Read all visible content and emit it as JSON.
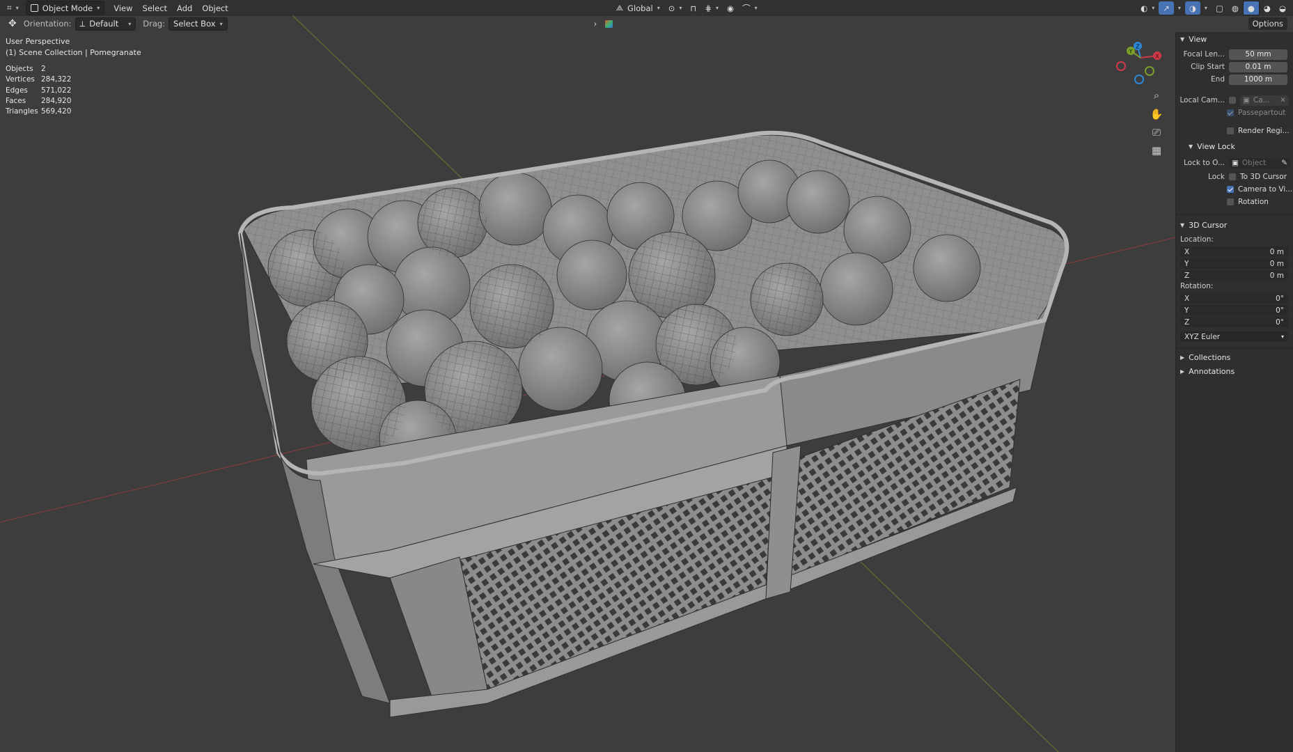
{
  "header": {
    "mode": "Object Mode",
    "menus": [
      "View",
      "Select",
      "Add",
      "Object"
    ],
    "transform_orientation": "Global",
    "options_label": "Options"
  },
  "tool_settings": {
    "orientation_label": "Orientation:",
    "orientation_value": "Default",
    "drag_label": "Drag:",
    "drag_value": "Select Box"
  },
  "viewport_info": {
    "perspective": "User Perspective",
    "collection": "(1) Scene Collection | Pomegranate"
  },
  "stats": [
    {
      "label": "Objects",
      "value": "2"
    },
    {
      "label": "Vertices",
      "value": "284,322"
    },
    {
      "label": "Edges",
      "value": "571,022"
    },
    {
      "label": "Faces",
      "value": "284,920"
    },
    {
      "label": "Triangles",
      "value": "569,420"
    }
  ],
  "gizmo": {
    "x": "X",
    "y": "Y",
    "z": "Z"
  },
  "npanel": {
    "view": {
      "title": "View",
      "focal_length_label": "Focal Len...",
      "focal_length": "50 mm",
      "clip_start_label": "Clip Start",
      "clip_start": "0.01 m",
      "end_label": "End",
      "end": "1000 m",
      "local_camera_label": "Local Cam...",
      "local_camera_value": "Ca...",
      "passepartout": "Passepartout",
      "render_region": "Render Regi..."
    },
    "view_lock": {
      "title": "View Lock",
      "lock_to_object_label": "Lock to O...",
      "lock_to_object_placeholder": "Object",
      "lock_label": "Lock",
      "to_3d_cursor": "To 3D Cursor",
      "camera_to_view": "Camera to Vi...",
      "rotation": "Rotation"
    },
    "cursor": {
      "title": "3D Cursor",
      "location_label": "Location:",
      "location": [
        {
          "axis": "X",
          "value": "0 m"
        },
        {
          "axis": "Y",
          "value": "0 m"
        },
        {
          "axis": "Z",
          "value": "0 m"
        }
      ],
      "rotation_label": "Rotation:",
      "rotation": [
        {
          "axis": "X",
          "value": "0°"
        },
        {
          "axis": "Y",
          "value": "0°"
        },
        {
          "axis": "Z",
          "value": "0°"
        }
      ],
      "rotation_mode": "XYZ Euler"
    },
    "collections": "Collections",
    "annotations": "Annotations"
  }
}
